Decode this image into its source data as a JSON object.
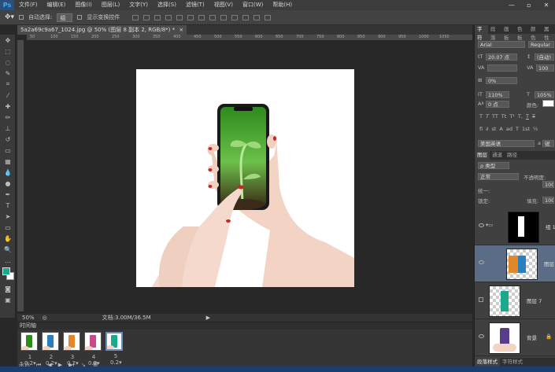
{
  "app": {
    "logo": "Ps"
  },
  "menu": [
    "文件(F)",
    "编辑(E)",
    "图像(I)",
    "图层(L)",
    "文字(Y)",
    "选择(S)",
    "滤镜(T)",
    "视图(V)",
    "窗口(W)",
    "帮助(H)"
  ],
  "window_controls": [
    "—",
    "▫",
    "✕"
  ],
  "options": {
    "auto_select_label": "自动选择:",
    "auto_select_value": "组",
    "show_transform_label": "显示变换控件"
  },
  "document": {
    "tab_title": "5a2a69c9a67_1024.jpg @ 50% (图层 8 副本 2, RGB/8*) *",
    "close": "×"
  },
  "ruler": {
    "top_ticks": [
      "50",
      "100",
      "150",
      "200",
      "250",
      "300",
      "350",
      "400",
      "450",
      "500",
      "550",
      "600",
      "650",
      "700",
      "750",
      "800",
      "850",
      "900",
      "950",
      "1000",
      "1050"
    ]
  },
  "status": {
    "zoom": "50%",
    "doc_size": "文档:3.00M/36.5M"
  },
  "timeline": {
    "title": "时间轴",
    "frames": [
      {
        "label": "1",
        "duration": "0.2▾"
      },
      {
        "label": "2",
        "duration": "0.2▾"
      },
      {
        "label": "3",
        "duration": "0.2▾"
      },
      {
        "label": "4",
        "duration": "0.2▾"
      },
      {
        "label": "5",
        "duration": "0.2▾"
      }
    ],
    "loop": "永远",
    "controls": [
      "⏮",
      "◀",
      "▶",
      "▶|",
      "↘",
      "🗑"
    ]
  },
  "character_panel": {
    "tabs": [
      "字符",
      "段落",
      "画板",
      "色板",
      "颜色",
      "属性"
    ],
    "font_family": "Arial",
    "font_style": "Regular",
    "font_size": "20.07 点",
    "leading": "(自动)",
    "kerning": "",
    "tracking": "100",
    "scale_label": "0%",
    "vscale": "110%",
    "hscale": "105%",
    "baseline": "0 点",
    "color_label": "颜色:",
    "style_buttons": [
      "T",
      "T",
      "TT",
      "Tt",
      "T¹",
      "T,",
      "T",
      "T"
    ],
    "ot_buttons": [
      "fi",
      "∂",
      "st",
      "A",
      "ad",
      "T",
      "1st",
      "½"
    ],
    "language": "美国英语",
    "aa": "a",
    "aa_value": "锐利"
  },
  "layers_panel": {
    "tabs": [
      "图层",
      "通道",
      "路径"
    ],
    "filter": "ρ 类型",
    "blend_mode": "正常",
    "opacity_label": "不透明度:",
    "opacity_value": "100",
    "lock_label": "锁定:",
    "unify_label": "统一:",
    "fill_label": "填充:",
    "fill_value": "100",
    "layers": [
      {
        "name": "组 1",
        "selected": false
      },
      {
        "name": "图层",
        "selected": true
      },
      {
        "name": "图层 7",
        "selected": false
      },
      {
        "name": "背景",
        "selected": false
      }
    ],
    "bottom_tabs": [
      "段落样式",
      "字符样式"
    ]
  },
  "colors": {
    "fg": "#1aa98d",
    "accent": "#5b6c87"
  }
}
